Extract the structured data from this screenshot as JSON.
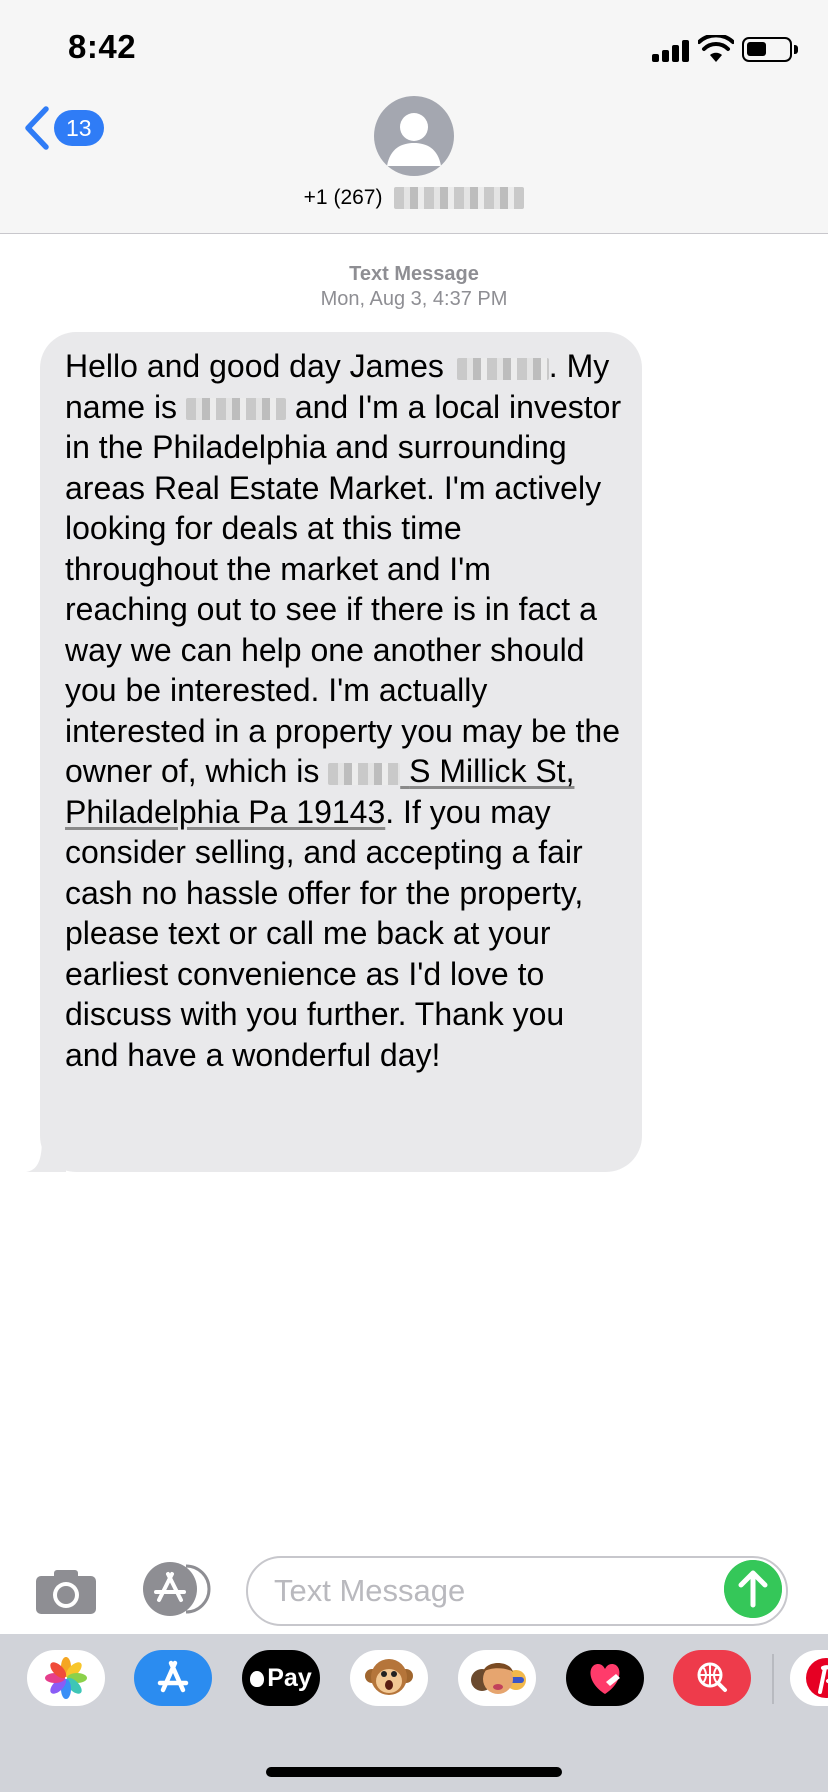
{
  "status_bar": {
    "time": "8:42"
  },
  "header": {
    "back_badge_count": "13",
    "contact_number": "+1 (267)"
  },
  "conversation": {
    "message_kind": "Text Message",
    "timestamp": "Mon, Aug 3, 4:37 PM",
    "message": {
      "greeting": "Hello and good day James",
      "intro_pre": ". My name is",
      "intro_post": "and I'm a local investor in the Philadelphia and surrounding areas Real Estate Market. I'm actively looking for deals at this time throughout the market and I'm reaching out to see if there is in fact a way we can help one another should you be interested. I'm actually interested in a property you may be the owner of, which is",
      "address_link": "S Millick St, Philadelphia Pa 19143",
      "closing": ". If you may consider selling, and accepting a fair cash no hassle offer for the property, please text or call me back at your earliest convenience as I'd love to discuss with you further. Thank you and have a wonderful day!"
    }
  },
  "composer": {
    "placeholder": "Text Message"
  },
  "app_drawer": {
    "apps": [
      {
        "name": "photos",
        "color": "#ffffff"
      },
      {
        "name": "app-store",
        "color": "#2b8cf0"
      },
      {
        "name": "apple-pay",
        "label": "Pay",
        "color": "#000000"
      },
      {
        "name": "animoji",
        "color": "#ffffff"
      },
      {
        "name": "memoji",
        "color": "#ffffff"
      },
      {
        "name": "digital-touch",
        "color": "#000000"
      },
      {
        "name": "web-search",
        "color": "#ee3b4b"
      },
      {
        "name": "pinterest",
        "color": "#e60023"
      }
    ]
  },
  "colors": {
    "accent_blue": "#2f7cf6",
    "send_green": "#35c759",
    "incoming_bubble": "#e9e9eb",
    "meta_gray": "#8e8e93"
  }
}
